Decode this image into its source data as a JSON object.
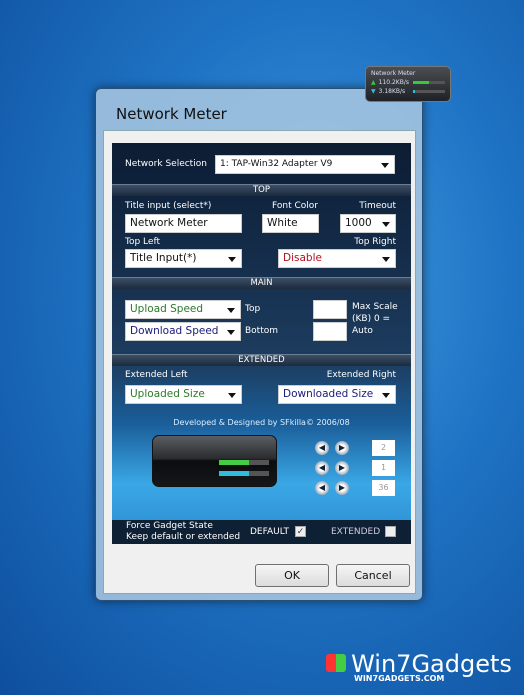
{
  "gadget": {
    "title": "Network Meter",
    "upload": "110.2KB/s",
    "download": "3.18KB/s",
    "upload_fill": 0.5,
    "download_fill": 0.05
  },
  "dialog": {
    "title": "Network Meter"
  },
  "network": {
    "label": "Network Selection",
    "value": "1: TAP-Win32 Adapter V9"
  },
  "top": {
    "header": "TOP",
    "title_label": "Title input (select*)",
    "title_value": "Network Meter",
    "font_color_label": "Font Color",
    "font_color_value": "White",
    "timeout_label": "Timeout",
    "timeout_value": "1000",
    "top_left_label": "Top Left",
    "top_left_value": "Title Input(*)",
    "top_right_label": "Top Right",
    "top_right_value": "Disable"
  },
  "main": {
    "header": "MAIN",
    "top_value": "Upload Speed",
    "top_label": "Top",
    "bottom_value": "Download Speed",
    "bottom_label": "Bottom",
    "max_scale_label": "Max Scale (KB) 0 = Auto",
    "max_top": "",
    "max_bottom": ""
  },
  "extended": {
    "header": "EXTENDED",
    "left_label": "Extended Left",
    "left_value": "Uploaded Size",
    "right_label": "Extended Right",
    "right_value": "Downloaded Size"
  },
  "credits": "Developed & Designed by SFkilla© 2006/08",
  "steppers": [
    "2",
    "1",
    "36"
  ],
  "force": {
    "line1": "Force Gadget State",
    "line2": "Keep default or extended",
    "default_label": "DEFAULT",
    "default_checked": true,
    "extended_label": "EXTENDED",
    "extended_checked": false
  },
  "buttons": {
    "ok": "OK",
    "cancel": "Cancel"
  },
  "colors": {
    "upload_text": "#2a7a2a",
    "download_text": "#1a1a7a",
    "disable_text": "#b01020"
  },
  "watermark": {
    "name": "Win7Gadgets",
    "url": "WIN7GADGETS.COM"
  }
}
